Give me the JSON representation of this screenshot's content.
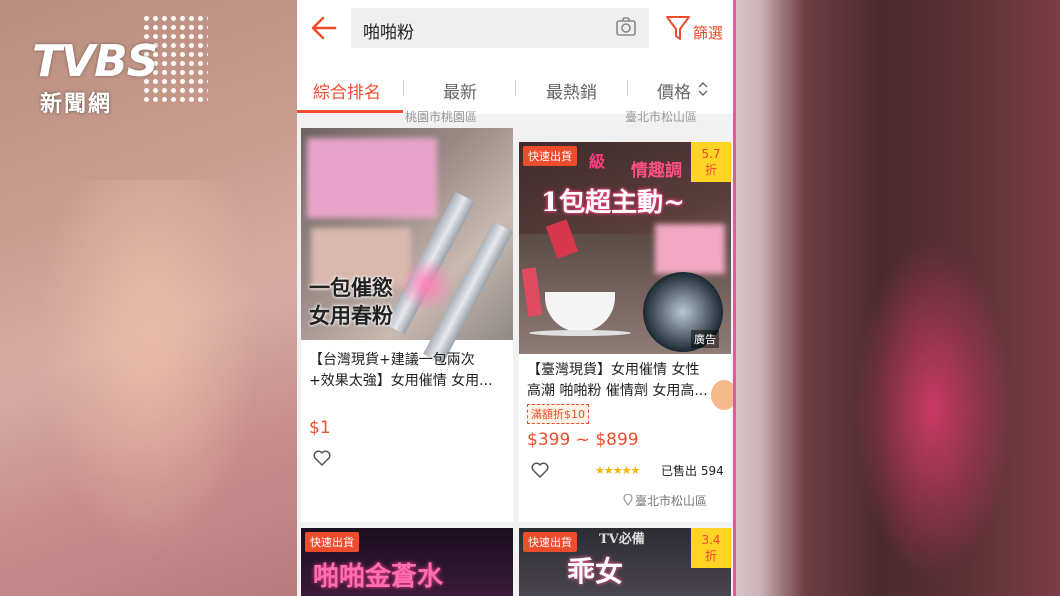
{
  "watermark": {
    "brand": "TVBS",
    "sub": "新聞網"
  },
  "search": {
    "query": "啪啪粉",
    "filter_label": "篩選"
  },
  "tabs": [
    {
      "label": "綜合排名",
      "active": true
    },
    {
      "label": "最新",
      "active": false
    },
    {
      "label": "最熱銷",
      "active": false
    },
    {
      "label": "價格",
      "active": false
    }
  ],
  "top_locations": [
    "桃園市桃園區",
    "臺北市松山區"
  ],
  "products": [
    {
      "image_text": [
        "一包催慾",
        "女用春粉"
      ],
      "title_line1": "【台灣現貨+建議一包兩次",
      "title_line2": "+效果太強】女用催情 女用...",
      "price": "$1"
    },
    {
      "badge": "快速出貨",
      "discount_value": "5.7",
      "discount_unit": "折",
      "image_text": [
        "情趣調",
        "1包超主動~",
        "級"
      ],
      "ad_label": "廣告",
      "title_line1": "【臺灣現貨】女用催情 女性",
      "title_line2": "高潮 啪啪粉 催情劑 女用高...",
      "promo": "滿額折$10",
      "price": "$399 ~ $899",
      "rating": 4.5,
      "stars": "★★★★★",
      "sold": "已售出 594",
      "location": "臺北市松山區"
    },
    {
      "badge": "快速出貨",
      "image_text": [
        "啪啪金蒼水"
      ]
    },
    {
      "badge": "快速出貨",
      "discount_value": "3.4",
      "discount_unit": "折",
      "image_text": [
        "TV必備",
        "乖女"
      ]
    }
  ],
  "colors": {
    "accent": "#ee4d2d",
    "discount_bg": "#ffd424"
  }
}
